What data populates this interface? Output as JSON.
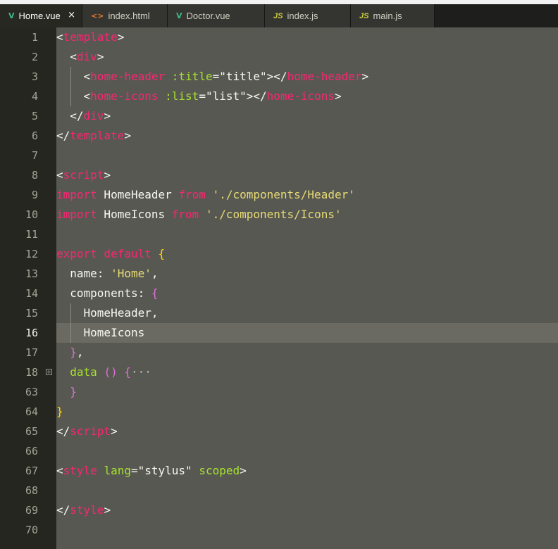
{
  "tabs": [
    {
      "icon": "vue-icon",
      "icon_glyph": "V",
      "label": "Home.vue",
      "active": true,
      "close": "×"
    },
    {
      "icon": "html-icon",
      "icon_glyph": "<>",
      "label": "index.html",
      "active": false
    },
    {
      "icon": "vue-icon",
      "icon_glyph": "V",
      "label": "Doctor.vue",
      "active": false
    },
    {
      "icon": "js-icon",
      "icon_glyph": "JS",
      "label": "index.js",
      "active": false
    },
    {
      "icon": "js-icon",
      "icon_glyph": "JS",
      "label": "main.js",
      "active": false
    }
  ],
  "current_line": "16",
  "lines": [
    {
      "n": "1",
      "tokens": [
        [
          "br",
          "<"
        ],
        [
          "tag",
          "template"
        ],
        [
          "br",
          ">"
        ]
      ]
    },
    {
      "n": "2",
      "tokens": [
        [
          "br",
          "  <"
        ],
        [
          "tag",
          "div"
        ],
        [
          "br",
          ">"
        ]
      ]
    },
    {
      "n": "3",
      "tokens": [
        [
          "br",
          "    <"
        ],
        [
          "tag",
          "home-header"
        ],
        [
          "br",
          " "
        ],
        [
          "attr",
          ":title"
        ],
        [
          "br",
          "="
        ],
        [
          "strw",
          "\"title\""
        ],
        [
          "br",
          "></"
        ],
        [
          "tag",
          "home-header"
        ],
        [
          "br",
          ">"
        ]
      ]
    },
    {
      "n": "4",
      "tokens": [
        [
          "br",
          "    <"
        ],
        [
          "tag",
          "home-icons"
        ],
        [
          "br",
          " "
        ],
        [
          "attr",
          ":list"
        ],
        [
          "br",
          "="
        ],
        [
          "strw",
          "\"list\""
        ],
        [
          "br",
          "></"
        ],
        [
          "tag",
          "home-icons"
        ],
        [
          "br",
          ">"
        ]
      ]
    },
    {
      "n": "5",
      "tokens": [
        [
          "br",
          "  </"
        ],
        [
          "tag",
          "div"
        ],
        [
          "br",
          ">"
        ]
      ]
    },
    {
      "n": "6",
      "tokens": [
        [
          "br",
          "</"
        ],
        [
          "tag",
          "template"
        ],
        [
          "br",
          ">"
        ]
      ]
    },
    {
      "n": "7",
      "tokens": []
    },
    {
      "n": "8",
      "tokens": [
        [
          "br",
          "<"
        ],
        [
          "tag",
          "script"
        ],
        [
          "br",
          ">"
        ]
      ]
    },
    {
      "n": "9",
      "tokens": [
        [
          "kw",
          "import"
        ],
        [
          "br",
          " HomeHeader "
        ],
        [
          "kw",
          "from"
        ],
        [
          "br",
          " "
        ],
        [
          "str",
          "'./components/Header'"
        ]
      ]
    },
    {
      "n": "10",
      "tokens": [
        [
          "kw",
          "import"
        ],
        [
          "br",
          " HomeIcons "
        ],
        [
          "kw",
          "from"
        ],
        [
          "br",
          " "
        ],
        [
          "str",
          "'./components/Icons'"
        ]
      ]
    },
    {
      "n": "11",
      "tokens": []
    },
    {
      "n": "12",
      "tokens": [
        [
          "kw",
          "export default"
        ],
        [
          "br",
          " "
        ],
        [
          "b1",
          "{"
        ]
      ]
    },
    {
      "n": "13",
      "tokens": [
        [
          "br",
          "  name: "
        ],
        [
          "str",
          "'Home'"
        ],
        [
          "br",
          ","
        ]
      ]
    },
    {
      "n": "14",
      "tokens": [
        [
          "br",
          "  components: "
        ],
        [
          "b2",
          "{"
        ]
      ]
    },
    {
      "n": "15",
      "tokens": [
        [
          "br",
          "    HomeHeader,"
        ]
      ]
    },
    {
      "n": "16",
      "tokens": [
        [
          "br",
          "    HomeIcons"
        ]
      ]
    },
    {
      "n": "17",
      "tokens": [
        [
          "br",
          "  "
        ],
        [
          "b2",
          "}"
        ],
        [
          "br",
          ","
        ]
      ]
    },
    {
      "n": "18",
      "fold": "+",
      "tokens": [
        [
          "attr",
          "  data"
        ],
        [
          "br",
          " "
        ],
        [
          "b2",
          "()"
        ],
        [
          "br",
          " "
        ],
        [
          "b2",
          "{"
        ],
        [
          "dots",
          "···"
        ]
      ]
    },
    {
      "n": "63",
      "tokens": [
        [
          "br",
          "  "
        ],
        [
          "b2",
          "}"
        ]
      ]
    },
    {
      "n": "64",
      "tokens": [
        [
          "b1",
          "}"
        ]
      ]
    },
    {
      "n": "65",
      "tokens": [
        [
          "br",
          "</"
        ],
        [
          "tag",
          "script"
        ],
        [
          "br",
          ">"
        ]
      ]
    },
    {
      "n": "66",
      "tokens": []
    },
    {
      "n": "67",
      "tokens": [
        [
          "br",
          "<"
        ],
        [
          "tag",
          "style"
        ],
        [
          "br",
          " "
        ],
        [
          "attr",
          "lang"
        ],
        [
          "br",
          "="
        ],
        [
          "strw",
          "\"stylus\""
        ],
        [
          "br",
          " "
        ],
        [
          "attr",
          "scoped"
        ],
        [
          "br",
          ">"
        ]
      ]
    },
    {
      "n": "68",
      "tokens": []
    },
    {
      "n": "69",
      "tokens": [
        [
          "br",
          "</"
        ],
        [
          "tag",
          "style"
        ],
        [
          "br",
          ">"
        ]
      ]
    },
    {
      "n": "70",
      "tokens": []
    }
  ],
  "colors": {
    "tag": "#f92672",
    "attribute": "#a6e22e",
    "string": "#e6db74",
    "text": "#f8f8f2",
    "brace_outer": "#ffd700",
    "brace_inner": "#da70d6",
    "editor_bg": "#585852",
    "gutter_bg": "#262620"
  }
}
